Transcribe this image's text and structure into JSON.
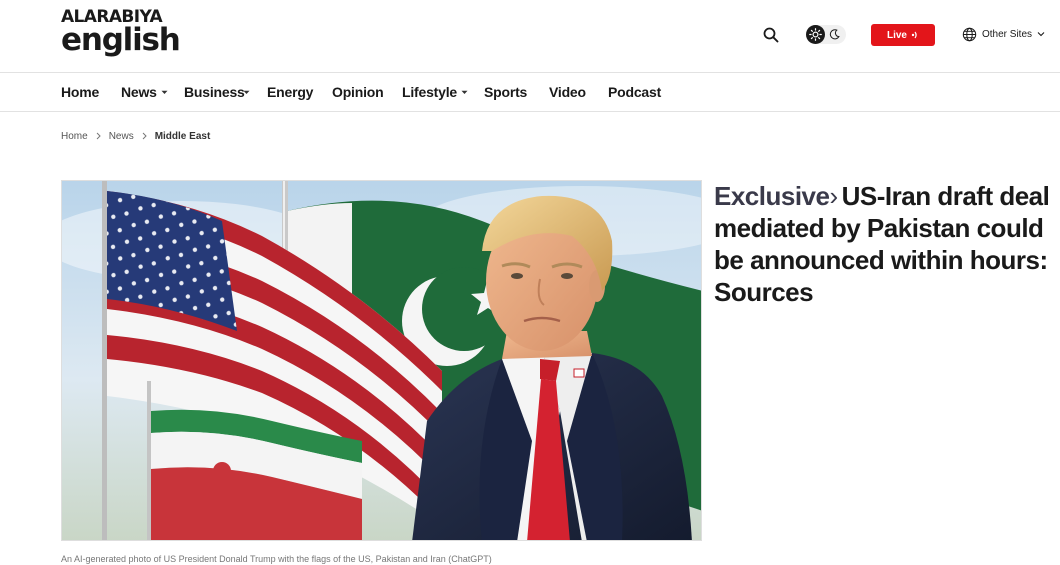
{
  "logo": {
    "line1": "ALARABIYA",
    "line2": "english"
  },
  "header": {
    "search_icon": "search-icon",
    "theme_icons": [
      "sun-icon",
      "moon-icon"
    ],
    "live_label": "Live",
    "other_sites_label": "Other Sites"
  },
  "nav": {
    "items": [
      {
        "label": "Home",
        "has_dropdown": false
      },
      {
        "label": "News",
        "has_dropdown": true
      },
      {
        "label": "Business",
        "has_dropdown": true
      },
      {
        "label": "Energy",
        "has_dropdown": false
      },
      {
        "label": "Opinion",
        "has_dropdown": false
      },
      {
        "label": "Lifestyle",
        "has_dropdown": true
      },
      {
        "label": "Sports",
        "has_dropdown": false
      },
      {
        "label": "Video",
        "has_dropdown": false
      },
      {
        "label": "Podcast",
        "has_dropdown": false
      }
    ]
  },
  "breadcrumb": {
    "items": [
      "Home",
      "News",
      "Middle East"
    ]
  },
  "article": {
    "kicker": "Exclusive",
    "kicker_separator": "›",
    "title": "US-Iran draft deal mediated by Pakistan could be announced within hours: Sources",
    "caption": "An AI-generated photo of US President Donald Trump with the flags of the US, Pakistan and Iran (ChatGPT)"
  },
  "colors": {
    "live_red": "#e3151a",
    "text_dark": "#1a1a1a",
    "border": "#e2e2e2"
  }
}
